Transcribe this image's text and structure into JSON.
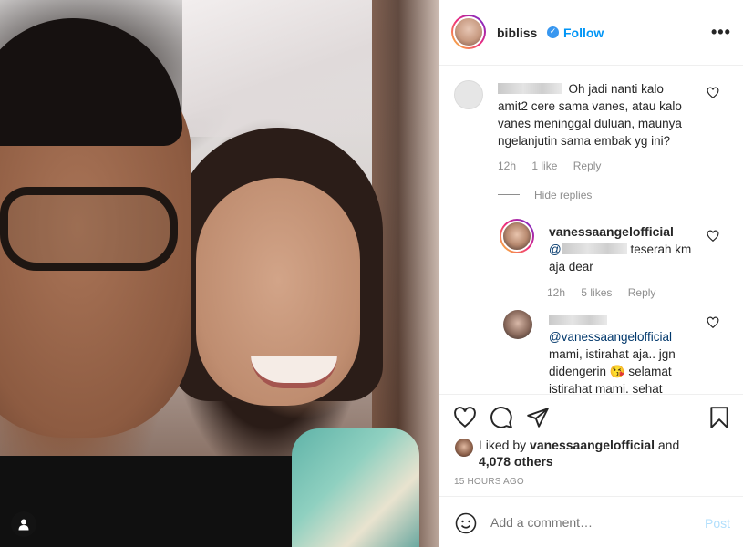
{
  "post": {
    "username": "bibliss",
    "follow_label": "Follow",
    "more_label": "•••"
  },
  "comments": {
    "first": {
      "text": "Oh jadi nanti kalo amit2 cere sama vanes, atau kalo vanes meninggal duluan, maunya ngelanjutin sama embak yg ini?",
      "time": "12h",
      "likes": "1 like",
      "reply_label": "Reply"
    },
    "hide_replies_label": "Hide replies",
    "reply1": {
      "username": "vanessaangelofficial",
      "mention_prefix": "@",
      "text": "teserah km aja dear",
      "time": "12h",
      "likes": "5 likes",
      "reply_label": "Reply"
    },
    "reply2": {
      "mention": "@vanessaangelofficial",
      "text": "mami, istirahat aja.. jgn didengerin 😘 selamat istirahat mami, sehat"
    }
  },
  "likes": {
    "prefix": "Liked by",
    "liker": "vanessaangelofficial",
    "and": "and",
    "others": "4,078 others"
  },
  "timestamp": "15 HOURS AGO",
  "add_comment": {
    "placeholder": "Add a comment…",
    "post_label": "Post"
  },
  "icons": {
    "heart": "heart-icon",
    "comment": "comment-icon",
    "share": "share-icon",
    "save": "bookmark-icon",
    "emoji": "emoji-icon",
    "user_tag": "user-tag-icon",
    "verified": "verified-badge-icon"
  },
  "colors": {
    "follow": "#0095f6",
    "verified": "#3897f0",
    "mention": "#00376b",
    "post_disabled": "#b2dffc"
  }
}
